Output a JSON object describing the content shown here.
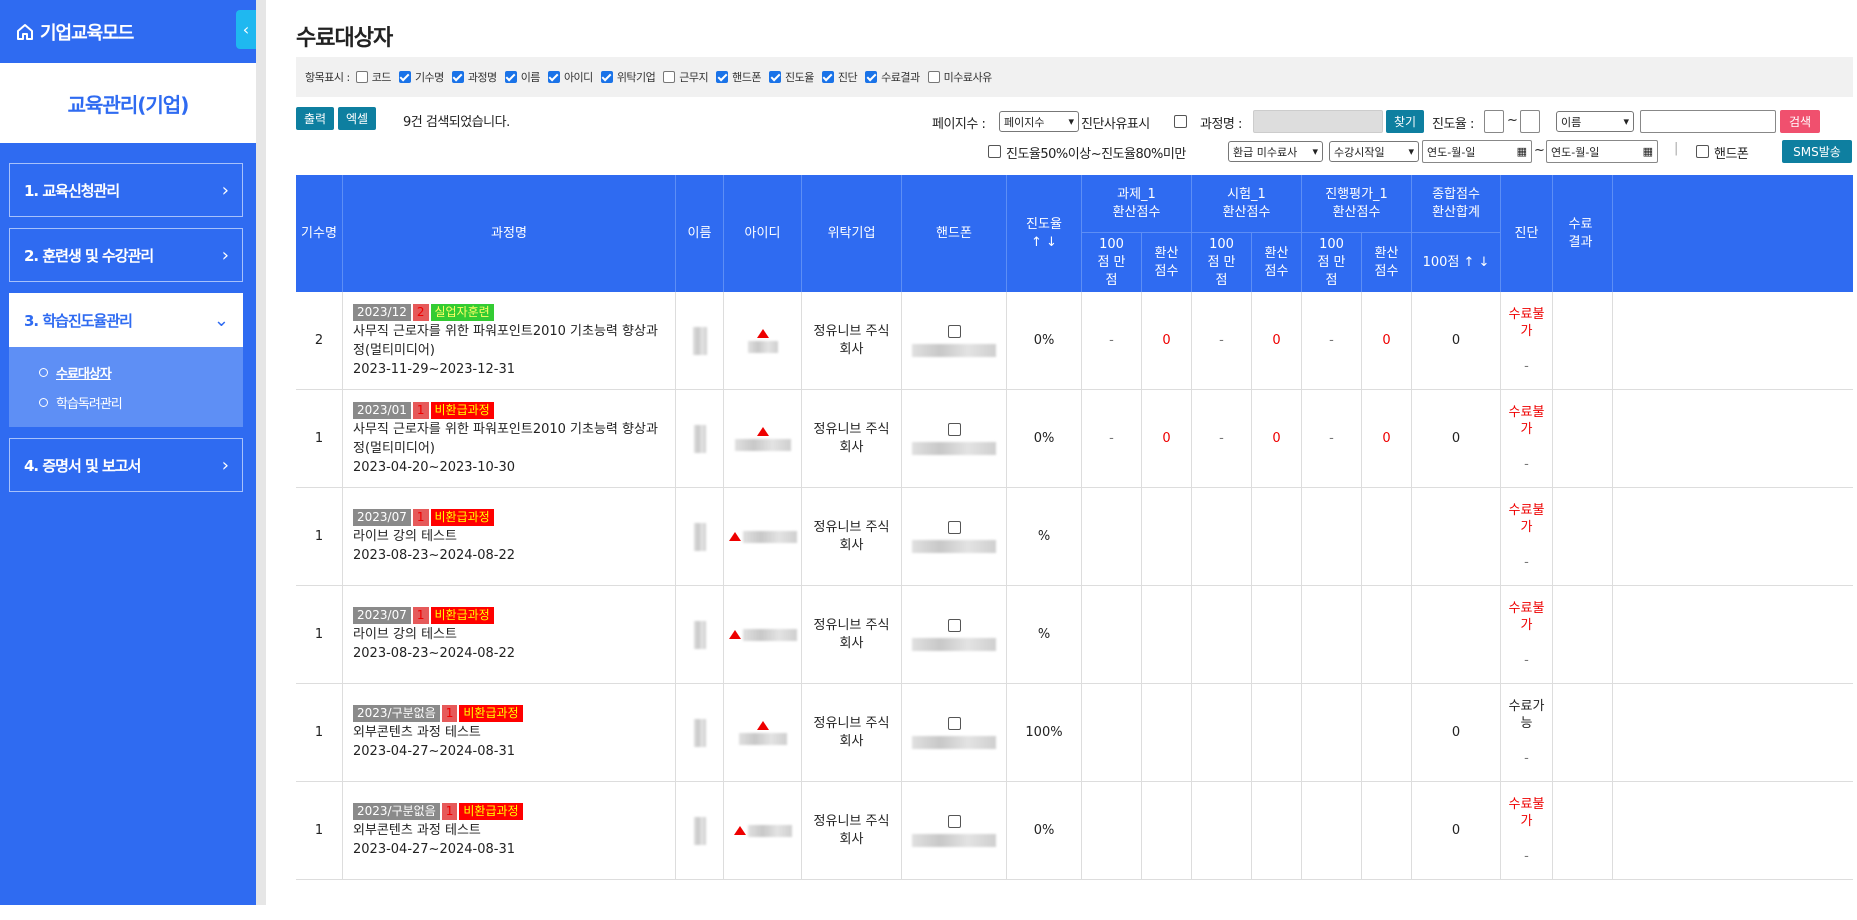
{
  "sidebar": {
    "brand": "기업교육모드",
    "collapse_icon": "‹",
    "title": "교육관리(기업)",
    "menu": [
      {
        "label": "1. 교육신청관리"
      },
      {
        "label": "2. 훈련생 및 수강관리"
      },
      {
        "label": "3. 학습진도율관리"
      },
      {
        "label": "4. 증명서 및 보고서"
      }
    ],
    "submenu": [
      {
        "label": "수료대상자"
      },
      {
        "label": "학습독려관리"
      }
    ]
  },
  "page": {
    "title": "수료대상자"
  },
  "display": {
    "label": "항목표시 :",
    "options": [
      {
        "label": "코드",
        "checked": false
      },
      {
        "label": "기수명",
        "checked": true
      },
      {
        "label": "과정명",
        "checked": true
      },
      {
        "label": "이름",
        "checked": true
      },
      {
        "label": "아이디",
        "checked": true
      },
      {
        "label": "위탁기업",
        "checked": true
      },
      {
        "label": "근무지",
        "checked": false
      },
      {
        "label": "핸드폰",
        "checked": true
      },
      {
        "label": "진도율",
        "checked": true
      },
      {
        "label": "진단",
        "checked": true
      },
      {
        "label": "수료결과",
        "checked": true
      },
      {
        "label": "미수료사유",
        "checked": false
      }
    ]
  },
  "toolbar": {
    "print": "출력",
    "excel": "엑셀",
    "result": "9건 검색되었습니다.",
    "page_count_label": "페이지수 :",
    "page_count_value": "페이지수",
    "diag_reason": "진단사유표시",
    "course_label": "과정명 :",
    "find": "찾기",
    "progress_label": "진도율 :",
    "tilde": "~",
    "name_select": "이름",
    "search": "검색",
    "range_filter": "진도율50%이상~진도율80%미만",
    "refund_select": "환급 미수료사",
    "start_select": "수강시작일",
    "date_from": "연도-월-일",
    "date_to": "연도-월-일",
    "phone": "핸드폰",
    "sms": "SMS발송"
  },
  "table": {
    "headers": {
      "cohort": "기수명",
      "course": "과정명",
      "name": "이름",
      "id": "아이디",
      "company": "위탁기업",
      "phone": "핸드폰",
      "progress": "진도율 ↑ ↓",
      "assign": "과제_1 환산점수",
      "exam": "시험_1 환산점수",
      "eval": "진행평가_1 환산점수",
      "total": "종합점수 환산합계",
      "full": "100점 만점",
      "conv": "환산 점수",
      "total_sub": "100점 ↑ ↓",
      "diag": "진단",
      "result": "수료결과"
    },
    "rows": [
      {
        "cohort": "2",
        "tag1": "2023/12",
        "tag2": "2",
        "tag3": "실업자훈련",
        "tag3_style": "green",
        "title": "사무직 근로자를 위한 파워포인트2010 기초능력 향상과정(멀티미디어)",
        "period": "2023-11-29~2023-12-31",
        "company": "정유니브 주식회사",
        "progress": "0%",
        "a_full": "-",
        "a_conv": "0",
        "e_full": "-",
        "e_conv": "0",
        "v_full": "-",
        "v_conv": "0",
        "total": "0",
        "diag": "수료불가",
        "diag_sub": "-",
        "result": ""
      },
      {
        "cohort": "1",
        "tag1": "2023/01",
        "tag2": "1",
        "tag3": "비환급과정",
        "tag3_style": "neon",
        "title": "사무직 근로자를 위한 파워포인트2010 기초능력 향상과정(멀티미디어)",
        "period": "2023-04-20~2023-10-30",
        "company": "정유니브 주식회사",
        "progress": "0%",
        "a_full": "-",
        "a_conv": "0",
        "e_full": "-",
        "e_conv": "0",
        "v_full": "-",
        "v_conv": "0",
        "total": "0",
        "diag": "수료불가",
        "diag_sub": "-",
        "result": ""
      },
      {
        "cohort": "1",
        "tag1": "2023/07",
        "tag2": "1",
        "tag3": "비환급과정",
        "tag3_style": "neon",
        "title": "라이브 강의 테스트",
        "period": "2023-08-23~2024-08-22",
        "company": "정유니브 주식회사",
        "progress": "%",
        "a_full": "",
        "a_conv": "",
        "e_full": "",
        "e_conv": "",
        "v_full": "",
        "v_conv": "",
        "total": "",
        "diag": "수료불가",
        "diag_sub": "-",
        "result": ""
      },
      {
        "cohort": "1",
        "tag1": "2023/07",
        "tag2": "1",
        "tag3": "비환급과정",
        "tag3_style": "neon",
        "title": "라이브 강의 테스트",
        "period": "2023-08-23~2024-08-22",
        "company": "정유니브 주식회사",
        "progress": "%",
        "a_full": "",
        "a_conv": "",
        "e_full": "",
        "e_conv": "",
        "v_full": "",
        "v_conv": "",
        "total": "",
        "diag": "수료불가",
        "diag_sub": "-",
        "result": ""
      },
      {
        "cohort": "1",
        "tag1": "2023/구분없음",
        "tag2": "1",
        "tag3": "비환급과정",
        "tag3_style": "neon",
        "title": "외부콘텐츠 과정 테스트",
        "period": "2023-04-27~2024-08-31",
        "company": "정유니브 주식회사",
        "progress": "100%",
        "a_full": "",
        "a_conv": "",
        "e_full": "",
        "e_conv": "",
        "v_full": "",
        "v_conv": "",
        "total": "0",
        "diag": "수료가능",
        "diag_sub": "-",
        "result": ""
      },
      {
        "cohort": "1",
        "tag1": "2023/구분없음",
        "tag2": "1",
        "tag3": "비환급과정",
        "tag3_style": "neon",
        "title": "외부콘텐츠 과정 테스트",
        "period": "2023-04-27~2024-08-31",
        "company": "정유니브 주식회사",
        "progress": "0%",
        "a_full": "",
        "a_conv": "",
        "e_full": "",
        "e_conv": "",
        "v_full": "",
        "v_conv": "",
        "total": "0",
        "diag": "수료불가",
        "diag_sub": "-",
        "result": ""
      }
    ]
  },
  "colors": {
    "sidebar": "#2f6bf1",
    "accent": "#0e7fa0",
    "danger": "#e00000"
  }
}
